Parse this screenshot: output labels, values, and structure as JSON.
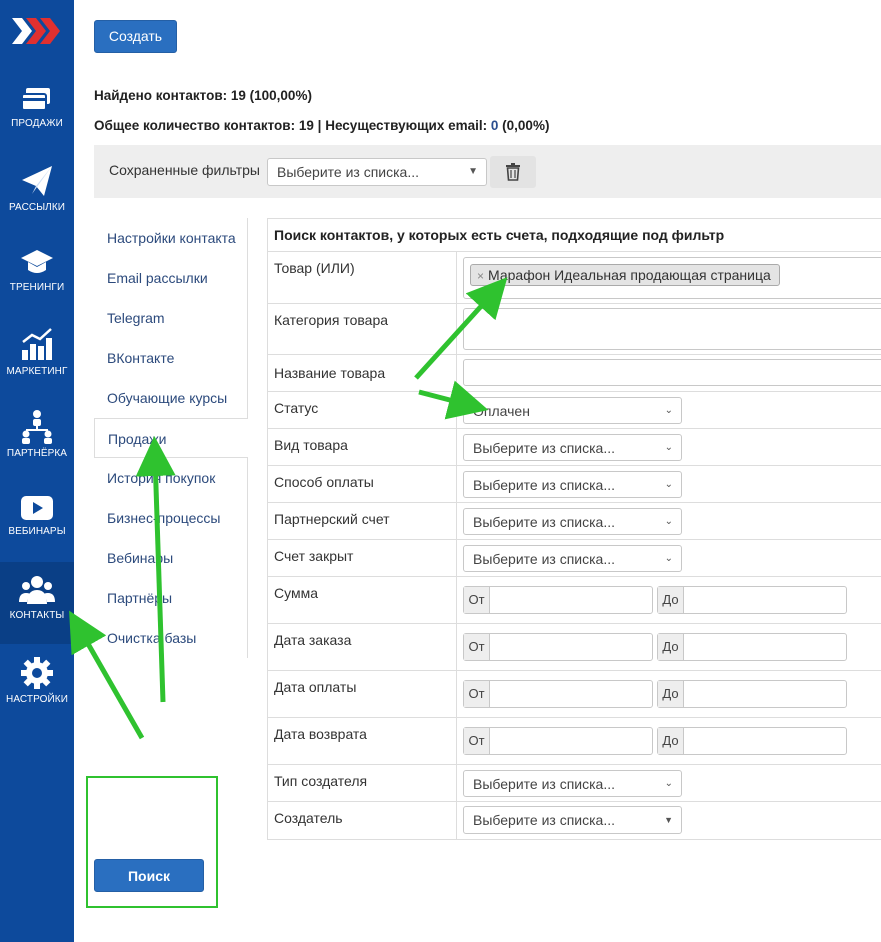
{
  "sidebar": {
    "items": [
      {
        "label": "ПРОДАЖИ",
        "icon": "credit-card-icon"
      },
      {
        "label": "РАССЫЛКИ",
        "icon": "paper-plane-icon"
      },
      {
        "label": "ТРЕНИНГИ",
        "icon": "graduation-cap-icon"
      },
      {
        "label": "МАРКЕТИНГ",
        "icon": "chart-growth-icon"
      },
      {
        "label": "ПАРТНЁРКА",
        "icon": "partners-network-icon"
      },
      {
        "label": "ВЕБИНАРЫ",
        "icon": "play-video-icon"
      },
      {
        "label": "КОНТАКТЫ",
        "icon": "users-group-icon"
      },
      {
        "label": "НАСТРОЙКИ",
        "icon": "gear-icon"
      }
    ],
    "active": "КОНТАКТЫ"
  },
  "toolbar": {
    "create_label": "Создать"
  },
  "stats": {
    "found_label": "Найдено контактов:",
    "found_value": "19 (100,00%)",
    "total_label": "Общее количество контактов:",
    "total_value": "19",
    "separator": "|",
    "invalid_label": "Несуществующих email:",
    "invalid_count": "0",
    "invalid_pct": "(0,00%)"
  },
  "saved_filters": {
    "label": "Сохраненные фильтры",
    "select_value": "Выберите из списка..."
  },
  "tabs": [
    "Настройки контакта",
    "Email рассылки",
    "Telegram",
    "ВКонтакте",
    "Обучающие курсы",
    "Продажи",
    "История покупок",
    "Бизнес-процессы",
    "Вебинары",
    "Партнёры",
    "Очистка базы"
  ],
  "active_tab": "Продажи",
  "filter": {
    "heading": "Поиск контактов, у которых есть счета, подходящие под фильтр",
    "rows": {
      "product": {
        "label": "Товар (ИЛИ)",
        "tag": "Марафон Идеальная продающая страница"
      },
      "category": {
        "label": "Категория товара"
      },
      "product_name": {
        "label": "Название товара"
      },
      "status": {
        "label": "Статус",
        "value": "Оплачен"
      },
      "product_type": {
        "label": "Вид товара",
        "value": "Выберите из списка..."
      },
      "payment_method": {
        "label": "Способ оплаты",
        "value": "Выберите из списка..."
      },
      "partner_invoice": {
        "label": "Партнерский счет",
        "value": "Выберите из списка..."
      },
      "invoice_closed": {
        "label": "Счет закрыт",
        "value": "Выберите из списка..."
      },
      "amount": {
        "label": "Сумма",
        "from": "От",
        "to": "До"
      },
      "order_date": {
        "label": "Дата заказа",
        "from": "От",
        "to": "До"
      },
      "payment_date": {
        "label": "Дата оплаты",
        "from": "От",
        "to": "До"
      },
      "refund_date": {
        "label": "Дата возврата",
        "from": "От",
        "to": "До"
      },
      "creator_type": {
        "label": "Тип создателя",
        "value": "Выберите из списка..."
      },
      "creator": {
        "label": "Создатель",
        "value": "Выберите из списка..."
      }
    }
  },
  "search": {
    "label": "Поиск"
  },
  "colors": {
    "sidebar": "#0d4a9c",
    "primary": "#2a6fc0",
    "annotation": "#2fc22f"
  }
}
